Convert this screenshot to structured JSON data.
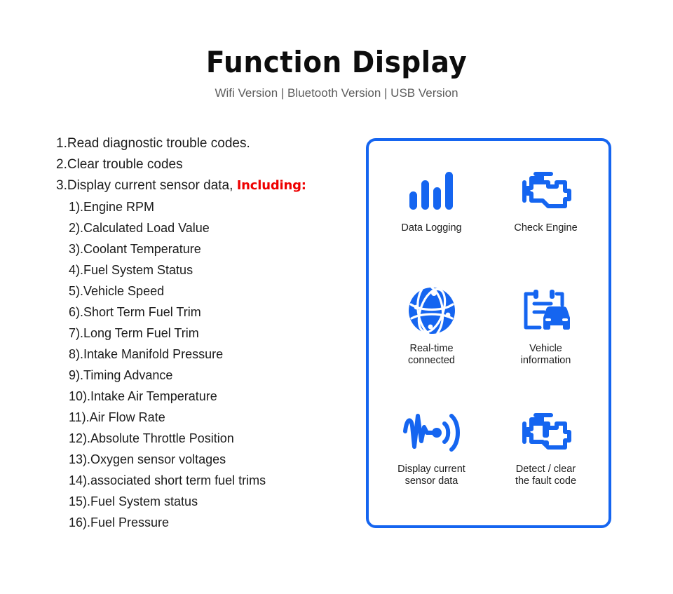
{
  "header": {
    "title": "Function Display",
    "subtitle": "Wifi Version | Bluetooth Version | USB Version"
  },
  "colors": {
    "brand_blue": "#1565f0",
    "emphasis_red": "#ee0000",
    "subtitle_gray": "#5c5c5c",
    "text_dark": "#1c1c1c"
  },
  "features": {
    "main": [
      "1.Read diagnostic trouble codes.",
      "2.Clear trouble codes"
    ],
    "main_third_prefix": "3.Display current sensor data, ",
    "main_third_emphasis": "Including:",
    "sub": [
      "1).Engine RPM",
      "2).Calculated Load Value",
      "3).Coolant Temperature",
      "4).Fuel System Status",
      "5).Vehicle Speed",
      "6).Short Term Fuel Trim",
      "7).Long Term Fuel Trim",
      "8).Intake Manifold Pressure",
      "9).Timing Advance",
      "10).Intake Air Temperature",
      "11).Air Flow Rate",
      "12).Absolute Throttle Position",
      "13).Oxygen sensor voltages",
      "14).associated short term fuel trims",
      "15).Fuel System status",
      "16).Fuel Pressure"
    ]
  },
  "icon_panel": {
    "items": [
      {
        "icon": "bar-chart-icon",
        "label": "Data Logging"
      },
      {
        "icon": "check-engine-icon",
        "label": "Check Engine"
      },
      {
        "icon": "globe-network-icon",
        "label": "Real-time\nconnected"
      },
      {
        "icon": "clipboard-car-icon",
        "label": "Vehicle\ninformation"
      },
      {
        "icon": "waveform-signal-icon",
        "label": "Display current\nsensor data"
      },
      {
        "icon": "engine-warning-icon",
        "label": "Detect / clear\nthe fault code"
      }
    ]
  }
}
